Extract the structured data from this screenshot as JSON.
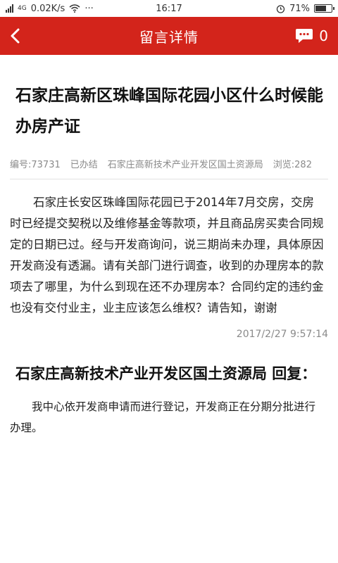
{
  "status_bar": {
    "network_type": "4G",
    "speed": "0.02K/s",
    "more": "···",
    "time": "16:17",
    "battery": "71%",
    "battery_level": 0.71
  },
  "header": {
    "title": "留言详情",
    "comment_count": "0",
    "bg_color": "#d3241b"
  },
  "message": {
    "title": "石家庄高新区珠峰国际花园小区什么时候能办房产证",
    "meta": {
      "number": "编号:73731",
      "status": "已办结",
      "department": "石家庄高新技术产业开发区国土资源局",
      "views": "浏览:282"
    },
    "body": "石家庄长安区珠峰国际花园已于2014年7月交房，交房时已经提交契税以及维修基金等款项，并且商品房买卖合同规定的日期已过。经与开发商询问，说三期尚未办理，具体原因开发商没有透漏。请有关部门进行调查，收到的办理房本的款项去了哪里，为什么到现在还不办理房本？合同约定的违约金也没有交付业主，业主应该怎么维权？请告知，谢谢",
    "timestamp": "2017/2/27 9:57:14"
  },
  "reply": {
    "title": "石家庄高新技术产业开发区国土资源局  回复：",
    "body": "我中心依开发商申请而进行登记，开发商正在分期分批进行办理。"
  }
}
